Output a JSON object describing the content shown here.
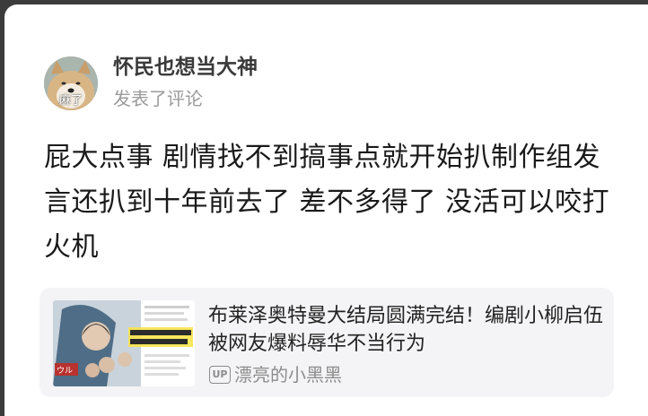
{
  "post": {
    "author": {
      "name": "怀民也想当大神",
      "action": "发表了评论",
      "avatar_caption": "麻了"
    },
    "content": "屁大点事 剧情找不到搞事点就开始扒制作组发言还扒到十年前去了 差不多得了 没活可以咬打火机"
  },
  "shared_video": {
    "title": "布莱泽奥特曼大结局圆满完结！编剧小柳启伍被网友爆料辱华不当行为",
    "uploader_badge": "UP",
    "uploader": "漂亮的小黑黑"
  },
  "colors": {
    "background": "#ffffff",
    "card_background": "#f4f4f6",
    "secondary_text": "#9b9b9b"
  }
}
